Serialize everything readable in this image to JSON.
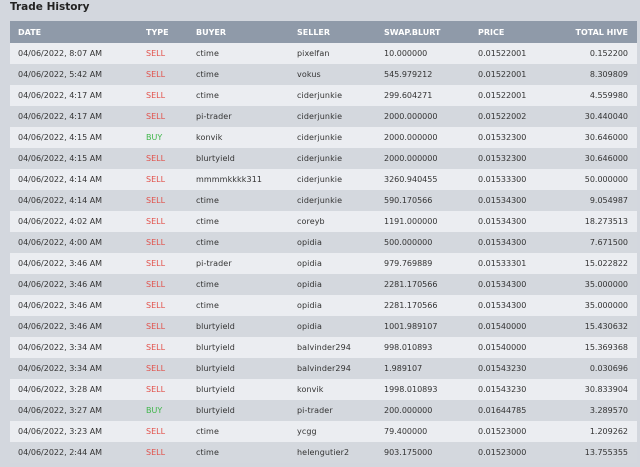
{
  "page": {
    "title": "Trade History"
  },
  "table": {
    "headers": [
      "DATE",
      "TYPE",
      "BUYER",
      "SELLER",
      "SWAP.BLURT",
      "PRICE",
      "TOTAL HIVE"
    ],
    "rows": [
      {
        "date": "04/06/2022, 8:07 AM",
        "type": "SELL",
        "buyer": "ctime",
        "seller": "pixelfan",
        "amount": "10.000000",
        "price": "0.01522001",
        "total": "0.152200"
      },
      {
        "date": "04/06/2022, 5:42 AM",
        "type": "SELL",
        "buyer": "ctime",
        "seller": "vokus",
        "amount": "545.979212",
        "price": "0.01522001",
        "total": "8.309809"
      },
      {
        "date": "04/06/2022, 4:17 AM",
        "type": "SELL",
        "buyer": "ctime",
        "seller": "ciderjunkie",
        "amount": "299.604271",
        "price": "0.01522001",
        "total": "4.559980"
      },
      {
        "date": "04/06/2022, 4:17 AM",
        "type": "SELL",
        "buyer": "pi-trader",
        "seller": "ciderjunkie",
        "amount": "2000.000000",
        "price": "0.01522002",
        "total": "30.440040"
      },
      {
        "date": "04/06/2022, 4:15 AM",
        "type": "BUY",
        "buyer": "konvik",
        "seller": "ciderjunkie",
        "amount": "2000.000000",
        "price": "0.01532300",
        "total": "30.646000"
      },
      {
        "date": "04/06/2022, 4:15 AM",
        "type": "SELL",
        "buyer": "blurtyield",
        "seller": "ciderjunkie",
        "amount": "2000.000000",
        "price": "0.01532300",
        "total": "30.646000"
      },
      {
        "date": "04/06/2022, 4:14 AM",
        "type": "SELL",
        "buyer": "mmmmkkkk311",
        "seller": "ciderjunkie",
        "amount": "3260.940455",
        "price": "0.01533300",
        "total": "50.000000"
      },
      {
        "date": "04/06/2022, 4:14 AM",
        "type": "SELL",
        "buyer": "ctime",
        "seller": "ciderjunkie",
        "amount": "590.170566",
        "price": "0.01534300",
        "total": "9.054987"
      },
      {
        "date": "04/06/2022, 4:02 AM",
        "type": "SELL",
        "buyer": "ctime",
        "seller": "coreyb",
        "amount": "1191.000000",
        "price": "0.01534300",
        "total": "18.273513"
      },
      {
        "date": "04/06/2022, 4:00 AM",
        "type": "SELL",
        "buyer": "ctime",
        "seller": "opidia",
        "amount": "500.000000",
        "price": "0.01534300",
        "total": "7.671500"
      },
      {
        "date": "04/06/2022, 3:46 AM",
        "type": "SELL",
        "buyer": "pi-trader",
        "seller": "opidia",
        "amount": "979.769889",
        "price": "0.01533301",
        "total": "15.022822"
      },
      {
        "date": "04/06/2022, 3:46 AM",
        "type": "SELL",
        "buyer": "ctime",
        "seller": "opidia",
        "amount": "2281.170566",
        "price": "0.01534300",
        "total": "35.000000"
      },
      {
        "date": "04/06/2022, 3:46 AM",
        "type": "SELL",
        "buyer": "ctime",
        "seller": "opidia",
        "amount": "2281.170566",
        "price": "0.01534300",
        "total": "35.000000"
      },
      {
        "date": "04/06/2022, 3:46 AM",
        "type": "SELL",
        "buyer": "blurtyield",
        "seller": "opidia",
        "amount": "1001.989107",
        "price": "0.01540000",
        "total": "15.430632"
      },
      {
        "date": "04/06/2022, 3:34 AM",
        "type": "SELL",
        "buyer": "blurtyield",
        "seller": "balvinder294",
        "amount": "998.010893",
        "price": "0.01540000",
        "total": "15.369368"
      },
      {
        "date": "04/06/2022, 3:34 AM",
        "type": "SELL",
        "buyer": "blurtyield",
        "seller": "balvinder294",
        "amount": "1.989107",
        "price": "0.01543230",
        "total": "0.030696"
      },
      {
        "date": "04/06/2022, 3:28 AM",
        "type": "SELL",
        "buyer": "blurtyield",
        "seller": "konvik",
        "amount": "1998.010893",
        "price": "0.01543230",
        "total": "30.833904"
      },
      {
        "date": "04/06/2022, 3:27 AM",
        "type": "BUY",
        "buyer": "blurtyield",
        "seller": "pi-trader",
        "amount": "200.000000",
        "price": "0.01644785",
        "total": "3.289570"
      },
      {
        "date": "04/06/2022, 3:23 AM",
        "type": "SELL",
        "buyer": "ctime",
        "seller": "ycgg",
        "amount": "79.400000",
        "price": "0.01523000",
        "total": "1.209262"
      },
      {
        "date": "04/06/2022, 2:44 AM",
        "type": "SELL",
        "buyer": "ctime",
        "seller": "helengutier2",
        "amount": "903.175000",
        "price": "0.01523000",
        "total": "13.755355"
      }
    ]
  },
  "colors": {
    "sell": "#e2504a",
    "buy": "#3fb64a",
    "header_bg": "#8f9aa9"
  }
}
